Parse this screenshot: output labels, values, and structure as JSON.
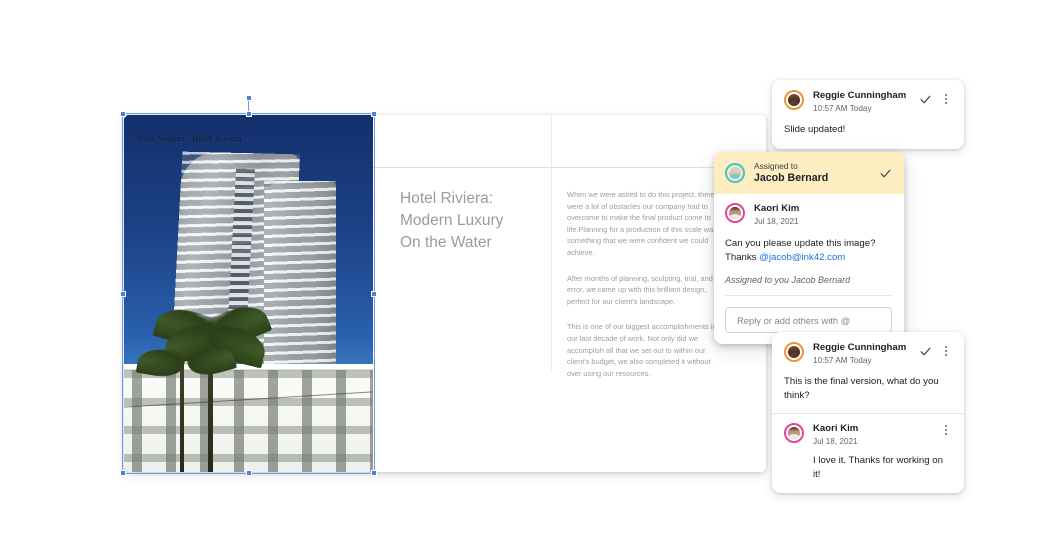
{
  "slide": {
    "image_caption_prefix": "Case Studies",
    "image_caption_title": "Hotel Riviera",
    "title": "Hotel Riviera:\nModern Luxury\nOn the Water",
    "body_paragraphs": [
      "When we were asked to do this project, there were a lot of obstacles our company had to overcome to make the final product come to life.Planning for a production of this scale was something that we were confident we could achieve.",
      "After months of planning, sculpting, trial, and error, we came up with this brilliant design, perfect for our client's landscape.",
      "This is one of our biggest accomplishments in our last decade of work. Not only did we accomplish all that we set out to within our client's budget, we also completed it without over using our resources."
    ]
  },
  "comments": {
    "top_card": {
      "author": "Reggie Cunningham",
      "timestamp": "10:57 AM Today",
      "text": "Slide updated!",
      "resolve_icon": "check-icon",
      "menu_icon": "more-vert-icon"
    },
    "active_card": {
      "assigned_label": "Assigned to",
      "assigned_name": "Jacob Bernard",
      "resolve_icon": "check-icon",
      "author": "Kaori Kim",
      "timestamp": "Jul 18, 2021",
      "text_line_1": "Can you please update this image?",
      "text_line_2_prefix": "Thanks ",
      "mention": "@jacob@ink42.com",
      "assignment_note": "Assigned to you Jacob Bernard",
      "reply_placeholder": "Reply or add others with @",
      "reply_value": ""
    },
    "bottom_card": {
      "author": "Reggie Cunningham",
      "timestamp": "10:57 AM Today",
      "text": "This is the final version, what do you think?",
      "resolve_icon": "check-icon",
      "menu_icon": "more-vert-icon",
      "reply_author": "Kaori Kim",
      "reply_timestamp": "Jul 18, 2021",
      "reply_text": "I love it. Thanks for working on it!",
      "reply_menu_icon": "more-vert-icon"
    }
  },
  "colors": {
    "assigned_band": "#FDEEC2",
    "mention_link": "#1A73E8",
    "selection": "#4A7FE0",
    "avatar_ring_reggie": "#F0933A",
    "avatar_ring_kaori": "#E8429A",
    "avatar_ring_jacob": "#45C2C9"
  }
}
